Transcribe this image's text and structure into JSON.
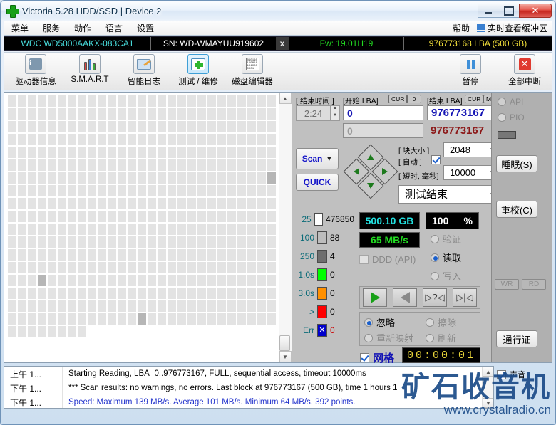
{
  "window": {
    "title": "Victoria 5.28 HDD/SSD | Device 2",
    "icon": "green-cross-icon",
    "buttons": {
      "minimize": "minimize-icon",
      "maximize": "maximize-icon",
      "close": "✕"
    }
  },
  "menubar": {
    "items": [
      "菜单",
      "服务",
      "动作",
      "语言",
      "设置"
    ],
    "help": "帮助",
    "realtime_cache": "实时查看缓冲区"
  },
  "drivebar": {
    "model": "WDC WD5000AAKX-083CA1",
    "serial": "SN: WD-WMAYUU919602",
    "x": "x",
    "firmware": "Fw: 19.01H19",
    "capacity": "976773168 LBA (500 GB)"
  },
  "toolbar": {
    "items": [
      {
        "label": "驱动器信息",
        "icon": "info-icon",
        "active": false
      },
      {
        "label": "S.M.A.R.T",
        "icon": "test-tubes-icon",
        "active": false
      },
      {
        "label": "智能日志",
        "icon": "folder-pencil-icon",
        "active": false
      },
      {
        "label": "测试 / 维修",
        "icon": "first-aid-kit-icon",
        "active": true
      },
      {
        "label": "磁盘编辑器",
        "icon": "hex-editor-icon",
        "active": false
      }
    ],
    "pause": {
      "label": "暂停",
      "icon": "pause-icon"
    },
    "stop_all": {
      "label": "全部中断",
      "icon": "stop-icon"
    }
  },
  "scan_controls": {
    "end_time_label": "[ 结束时间 ]",
    "end_time_value": "2:24",
    "start_lba_label": "[开始 LBA]",
    "start_lba_cur": "CUR",
    "start_lba_zero": "0",
    "start_lba_value": "0",
    "start_lba_second": "0",
    "end_lba_label": "[结束 LBA]",
    "end_lba_cur": "CUR",
    "end_lba_max": "MAX",
    "end_lba_value": "976773167",
    "end_lba_second": "976773167",
    "scan_button": "Scan",
    "quick_button": "QUICK",
    "block_size_label": "[ 块大小 ]",
    "block_size_value": "2048",
    "auto_label": "[ 自动 ]",
    "auto_checked": true,
    "timeout_label": "[ 短时, 毫秒]",
    "timeout_value": "10000",
    "end_action": "测试结束"
  },
  "legend": [
    {
      "threshold": "25",
      "color": "#ffffff",
      "count": "476850"
    },
    {
      "threshold": "100",
      "color": "#bdbdbd",
      "count": "88"
    },
    {
      "threshold": "250",
      "color": "#6e6e6e",
      "count": "4"
    },
    {
      "threshold": "1.0s",
      "color": "#00ff00",
      "count": "0"
    },
    {
      "threshold": "3.0s",
      "color": "#ff9000",
      "count": "0"
    },
    {
      "threshold": ">",
      "color": "#ff0000",
      "count": "0"
    },
    {
      "threshold": "Err",
      "color": "#0000cc",
      "count": "0"
    }
  ],
  "status": {
    "capacity_done": "500.10 GB",
    "percent": "100",
    "percent_unit": "%",
    "speed": "65 MB/s",
    "ddd_api_label": "DDD (API)",
    "ddd_api_checked": false,
    "mode_options": [
      {
        "label": "验证",
        "selected": false
      },
      {
        "label": "读取",
        "selected": true
      },
      {
        "label": "写入",
        "selected": false
      }
    ],
    "nav_buttons": [
      "play-forward-icon",
      "play-reverse-icon",
      "scan-question-icon",
      "jump-end-icon"
    ],
    "actions": [
      {
        "label": "忽略",
        "selected": true
      },
      {
        "label": "擦除",
        "selected": false
      },
      {
        "label": "重新映射",
        "selected": false
      },
      {
        "label": "刷新",
        "selected": false
      }
    ],
    "grid_label": "网格",
    "grid_checked": true,
    "timer": "00:00:01"
  },
  "sidebar": {
    "api_label": "API",
    "api_selected": true,
    "pio_label": "PIO",
    "pio_selected": false,
    "sleep_button": "睡眠(S)",
    "recalibrate_button": "重校(C)",
    "wr_label": "WR",
    "rd_label": "RD",
    "pass_button": "通行证"
  },
  "log": {
    "rows": [
      {
        "time": "上午 1...",
        "message": "Starting Reading, LBA=0..976773167, FULL, sequential access, timeout 10000ms",
        "color": "#000000"
      },
      {
        "time": "下午 1...",
        "message": "*** Scan results: no warnings, no errors. Last block at 976773167 (500 GB), time 1 hours 1",
        "color": "#000000"
      },
      {
        "time": "下午 1...",
        "message": "Speed: Maximum 139 MB/s. Average 101 MB/s. Minimum 64 MB/s. 392 points.",
        "color": "#2233cc"
      }
    ],
    "sound_label": "声音",
    "sound_checked": true
  },
  "watermark": {
    "cn": "矿石收音机",
    "url": "www.crystalradio.cn"
  },
  "grid_map": {
    "total_cells": 494,
    "cells_per_row": 26,
    "last_row_cells": 18,
    "dark_indices": [
      188,
      381,
      472
    ]
  }
}
